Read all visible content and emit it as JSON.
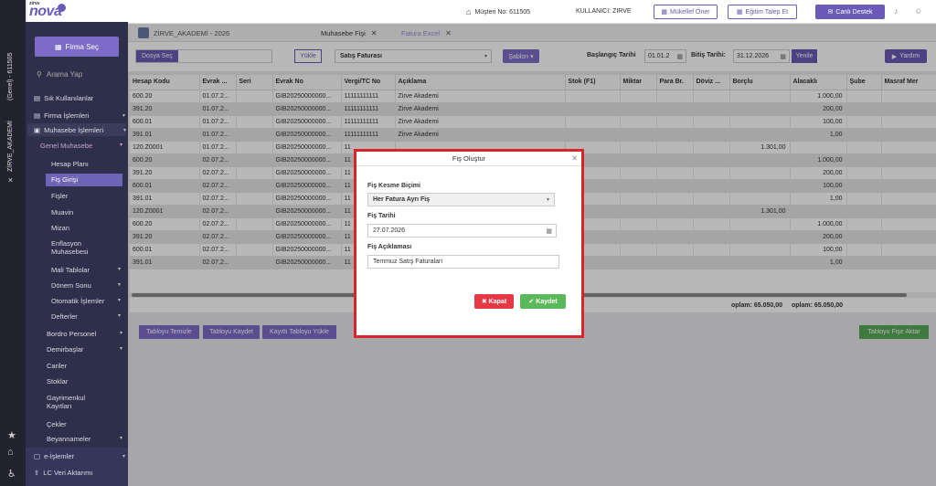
{
  "app": {
    "logo_small": "zirve",
    "logo_name": "nova"
  },
  "left_strip": {
    "label_top": "(Genel) - 611505",
    "label_mid": "ZİRVE_AKADEMİ",
    "close": "✕"
  },
  "sidebar": {
    "firma_sec": "Firma Seç",
    "search_placeholder": "Arama Yap",
    "items": {
      "sik": "Sık Kullanılanlar",
      "firma_islemleri": "Firma İşlemleri",
      "muhasebe_islemleri": "Muhasebe İşlemleri",
      "genel_muhasebe": "Genel Muhasebe",
      "hesap_plani": "Hesap Planı",
      "fis_girisi": "Fiş Girişi",
      "fisler": "Fişler",
      "muavin": "Muavin",
      "mizan": "Mizan",
      "enflasyon": "Enflasyon Muhasebesi",
      "mali_tablolar": "Mali Tablolar",
      "donem_sonu": "Dönem Sonu",
      "otomatik": "Otomatik İşlemler",
      "defterler": "Defterler",
      "bordro": "Bordro Personel",
      "demirbaslar": "Demirbaşlar",
      "cariler": "Cariler",
      "stoklar": "Stoklar",
      "gayrimenkul": "Gayrimenkul Kayıtları",
      "cekler": "Çekler",
      "beyannameler": "Beyannameler",
      "e_islemler": "e-İşlemler",
      "lc_veri": "LC Veri Aktarımı"
    }
  },
  "header": {
    "musteri_no": "Müşteri No: 611505",
    "kullanici": "KULLANICI: ZIRVE",
    "mukellef_oner": "Mükellef Öner",
    "egitim_talep": "Eğitim Talep Et",
    "canli_destek": "Canlı Destek"
  },
  "tabs": {
    "company": "ZİRVE_AKADEMİ - 2026",
    "muhasebe_fisi": "Muhasebe Fişi",
    "fatura_excel": "Fatura Excel"
  },
  "toolbar": {
    "dosya_sec": "Dosya Seç",
    "yukle": "Yükle",
    "fatura_turu": "Satış Faturası",
    "sablon": "Şablon ▾",
    "baslangic_label": "Başlangıç Tarihi",
    "baslangic_value": "01.01.2",
    "bitis_label": "Bitiş Tarihi:",
    "bitis_value": "31.12.2026",
    "yenile": "Yenile",
    "yardim": "Yardım"
  },
  "grid": {
    "headers": [
      "Hesap Kodu",
      "Evrak ...",
      "Seri",
      "Evrak No",
      "Vergi/TC No",
      "Açıklama",
      "Stok (F1)",
      "Miktar",
      "Para Br.",
      "Döviz ...",
      "Borçlu",
      "Alacaklı",
      "Şube",
      "Masraf Mer"
    ],
    "rows": [
      [
        "600.20",
        "01.07.2...",
        "",
        "GIB20250000000...",
        "11111111111",
        "Zirve Akademi",
        "",
        "",
        "",
        "",
        "",
        "1.000,00",
        "",
        ""
      ],
      [
        "391.20",
        "01.07.2...",
        "",
        "GIB20250000000...",
        "11111111111",
        "Zirve Akademi",
        "",
        "",
        "",
        "",
        "",
        "200,00",
        "",
        ""
      ],
      [
        "600.01",
        "01.07.2...",
        "",
        "GIB20250000000...",
        "11111111111",
        "Zirve Akademi",
        "",
        "",
        "",
        "",
        "",
        "100,00",
        "",
        ""
      ],
      [
        "391.01",
        "01.07.2...",
        "",
        "GIB20250000000...",
        "11111111111",
        "Zirve Akademi",
        "",
        "",
        "",
        "",
        "",
        "1,00",
        "",
        ""
      ],
      [
        "120.Z0001",
        "01.07.2...",
        "",
        "GIB20250000000...",
        "11",
        "",
        "",
        "",
        "",
        "",
        "1.301,00",
        "",
        "",
        ""
      ],
      [
        "600.20",
        "02.07.2...",
        "",
        "GIB20250000000...",
        "11",
        "",
        "",
        "",
        "",
        "",
        "",
        "1.000,00",
        "",
        ""
      ],
      [
        "391.20",
        "02.07.2...",
        "",
        "GIB20250000000...",
        "11",
        "",
        "",
        "",
        "",
        "",
        "",
        "200,00",
        "",
        ""
      ],
      [
        "600.01",
        "02.07.2...",
        "",
        "GIB20250000000...",
        "11",
        "",
        "",
        "",
        "",
        "",
        "",
        "100,00",
        "",
        ""
      ],
      [
        "391.01",
        "02.07.2...",
        "",
        "GIB20250000000...",
        "11",
        "",
        "",
        "",
        "",
        "",
        "",
        "1,00",
        "",
        ""
      ],
      [
        "120.Z0001",
        "02.07.2...",
        "",
        "GIB20250000000...",
        "11",
        "",
        "",
        "",
        "",
        "",
        "1.301,00",
        "",
        "",
        ""
      ],
      [
        "600.20",
        "02.07.2...",
        "",
        "GIB20250000000...",
        "11",
        "",
        "",
        "",
        "",
        "",
        "",
        "1.000,00",
        "",
        ""
      ],
      [
        "391.20",
        "02.07.2...",
        "",
        "GIB20250000000...",
        "11",
        "",
        "",
        "",
        "",
        "",
        "",
        "200,00",
        "",
        ""
      ],
      [
        "600.01",
        "02.07.2...",
        "",
        "GIB20250000000...",
        "11",
        "",
        "",
        "",
        "",
        "",
        "",
        "100,00",
        "",
        ""
      ],
      [
        "391.01",
        "02.07.2...",
        "",
        "GIB20250000000...",
        "11",
        "",
        "",
        "",
        "",
        "",
        "",
        "1,00",
        "",
        ""
      ]
    ],
    "total_borclu": "oplam: 65.050,00",
    "total_alacakli": "oplam: 65.050,00"
  },
  "bottom_buttons": {
    "temizle": "Tabloyu Temizle",
    "kaydet": "Tabloyu Kaydet",
    "kayitli_yukle": "Kayıtlı Tabloyu Yükle",
    "fise_aktar": "Tabloyu Fişe Aktar"
  },
  "modal": {
    "title": "Fiş Oluştur",
    "kesme_label": "Fiş Kesme Biçimi",
    "kesme_value": "Her Fatura Ayrı Fiş",
    "tarih_label": "Fiş Tarihi",
    "tarih_value": "27.07.2026",
    "aciklama_label": "Fiş Açıklaması",
    "aciklama_value": "Temmuz Satış Faturaları",
    "kapat": "Kapat",
    "kaydet": "Kaydet"
  }
}
